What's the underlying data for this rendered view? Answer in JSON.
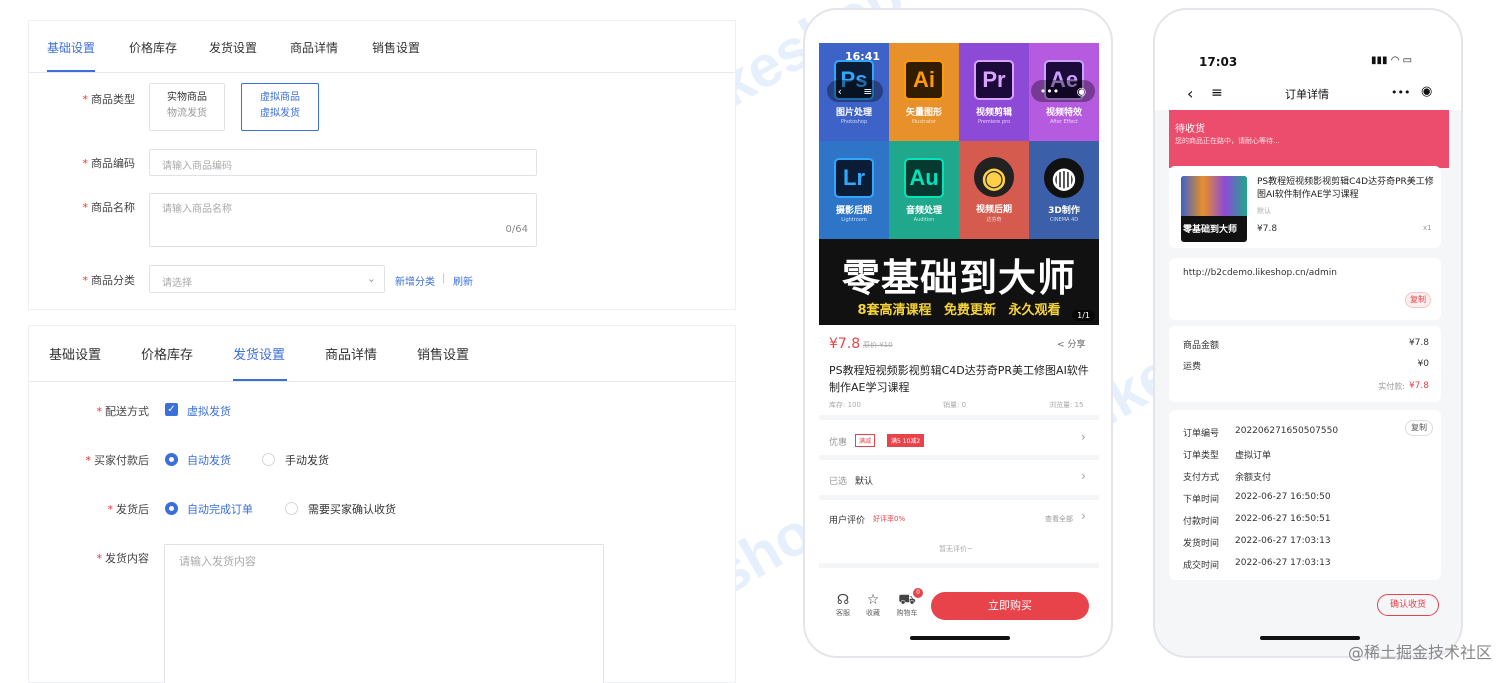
{
  "watermark": "Likeshop",
  "form1": {
    "tabs": [
      "基础设置",
      "价格库存",
      "发货设置",
      "商品详情",
      "销售设置"
    ],
    "type_label": "商品类型",
    "type_opts": [
      {
        "title": "实物商品",
        "sub": "物流发货"
      },
      {
        "title": "虚拟商品",
        "sub": "虚拟发货"
      }
    ],
    "code_label": "商品编码",
    "code_ph": "请输入商品编码",
    "name_label": "商品名称",
    "name_ph": "请输入商品名称",
    "name_count": "0/64",
    "cat_label": "商品分类",
    "cat_ph": "请选择",
    "cat_add": "新增分类",
    "cat_sep": "|",
    "cat_refresh": "刷新"
  },
  "form2": {
    "tabs": [
      "基础设置",
      "价格库存",
      "发货设置",
      "商品详情",
      "销售设置"
    ],
    "ship_label": "配送方式",
    "ship_value": "虚拟发货",
    "pay_label": "买家付款后",
    "pay_opts": [
      "自动发货",
      "手动发货"
    ],
    "after_label": "发货后",
    "after_opts": [
      "自动完成订单",
      "需要买家确认收货"
    ],
    "content_label": "发货内容",
    "content_ph": "请输入发货内容"
  },
  "phone1": {
    "time": "16:41",
    "apps": [
      {
        "abbr": "Ps",
        "cap": "图片处理",
        "sub": "Photoshop",
        "bg": "#3d63c9",
        "fg": "#31a8ff",
        "box": "#0b1d36"
      },
      {
        "abbr": "Ai",
        "cap": "矢量图形",
        "sub": "Illustrator",
        "bg": "#e8902a",
        "fg": "#ff9a00",
        "box": "#331d00"
      },
      {
        "abbr": "Pr",
        "cap": "视频剪辑",
        "sub": "Premiere pro",
        "bg": "#8c4ad6",
        "fg": "#d9a3ff",
        "box": "#1c0a3a"
      },
      {
        "abbr": "Ae",
        "cap": "视频特效",
        "sub": "After Effect",
        "bg": "#b65ae0",
        "fg": "#c9a3ff",
        "box": "#1c0a3a"
      },
      {
        "abbr": "Lr",
        "cap": "摄影后期",
        "sub": "Lightroom",
        "bg": "#2e75c8",
        "fg": "#31a8ff",
        "box": "#0b1d36"
      },
      {
        "abbr": "Au",
        "cap": "音频处理",
        "sub": "Audition",
        "bg": "#1fa88c",
        "fg": "#00e4bb",
        "box": "#063a30"
      },
      {
        "abbr": "◉",
        "cap": "视频后期",
        "sub": "达芬奇",
        "bg": "#d45b4e",
        "fg": "#ffd046",
        "box": "#222"
      },
      {
        "abbr": "◍",
        "cap": "3D制作",
        "sub": "CINEMA 4D",
        "bg": "#3b5fa8",
        "fg": "#ffffff",
        "box": "#111"
      }
    ],
    "banner_big": "零基础到大师",
    "banner_small": "8套高清课程 免费更新 永久观看",
    "pager": "1/1",
    "price": "¥7.8",
    "orig_price": "原价 ¥10",
    "share": "分享",
    "title": "PS教程短视频影视剪辑C4D达芬奇PR美工修图AI软件制作AE学习课程",
    "stock": "库存: 100",
    "sales": "销量: 0",
    "views": "浏览量: 15",
    "coupon_label": "优惠",
    "coupon_tag1": "满减",
    "coupon_tag2": "满5 10减2",
    "selected_label": "已选",
    "selected_value": "默认",
    "review_label": "用户评价",
    "review_rate": "好评率0%",
    "review_all": "查看全部",
    "no_review": "暂无评价~",
    "nav": [
      "客服",
      "收藏",
      "购物车"
    ],
    "cart_badge": "0",
    "buy": "立即购买"
  },
  "phone2": {
    "time": "17:03",
    "nav_title": "订单详情",
    "status": "待收货",
    "status_sub": "您的商品正在路中，请耐心等待...",
    "item_title": "PS教程短视频影视剪辑C4D达芬奇PR美工修图AI软件制作AE学习课程",
    "item_spec": "默认",
    "item_price": "¥7.8",
    "item_qty": "x1",
    "thumb_text": "零基础到大师",
    "url": "http://b2cdemo.likeshop.cn/admin",
    "copy": "复制",
    "amount_label": "商品金额",
    "amount": "¥7.8",
    "freight_label": "运费",
    "freight": "¥0",
    "paid_label": "实付款:",
    "paid": "¥7.8",
    "order_rows": [
      {
        "k": "订单编号",
        "v": "202206271650507550"
      },
      {
        "k": "订单类型",
        "v": "虚拟订单"
      },
      {
        "k": "支付方式",
        "v": "余额支付"
      },
      {
        "k": "下单时间",
        "v": "2022-06-27 16:50:50"
      },
      {
        "k": "付款时间",
        "v": "2022-06-27 16:50:51"
      },
      {
        "k": "发货时间",
        "v": "2022-06-27 17:03:13"
      },
      {
        "k": "成交时间",
        "v": "2022-06-27 17:03:13"
      }
    ],
    "copy2": "复制",
    "confirm": "确认收货"
  },
  "corner_wm": "@稀土掘金技术社区"
}
